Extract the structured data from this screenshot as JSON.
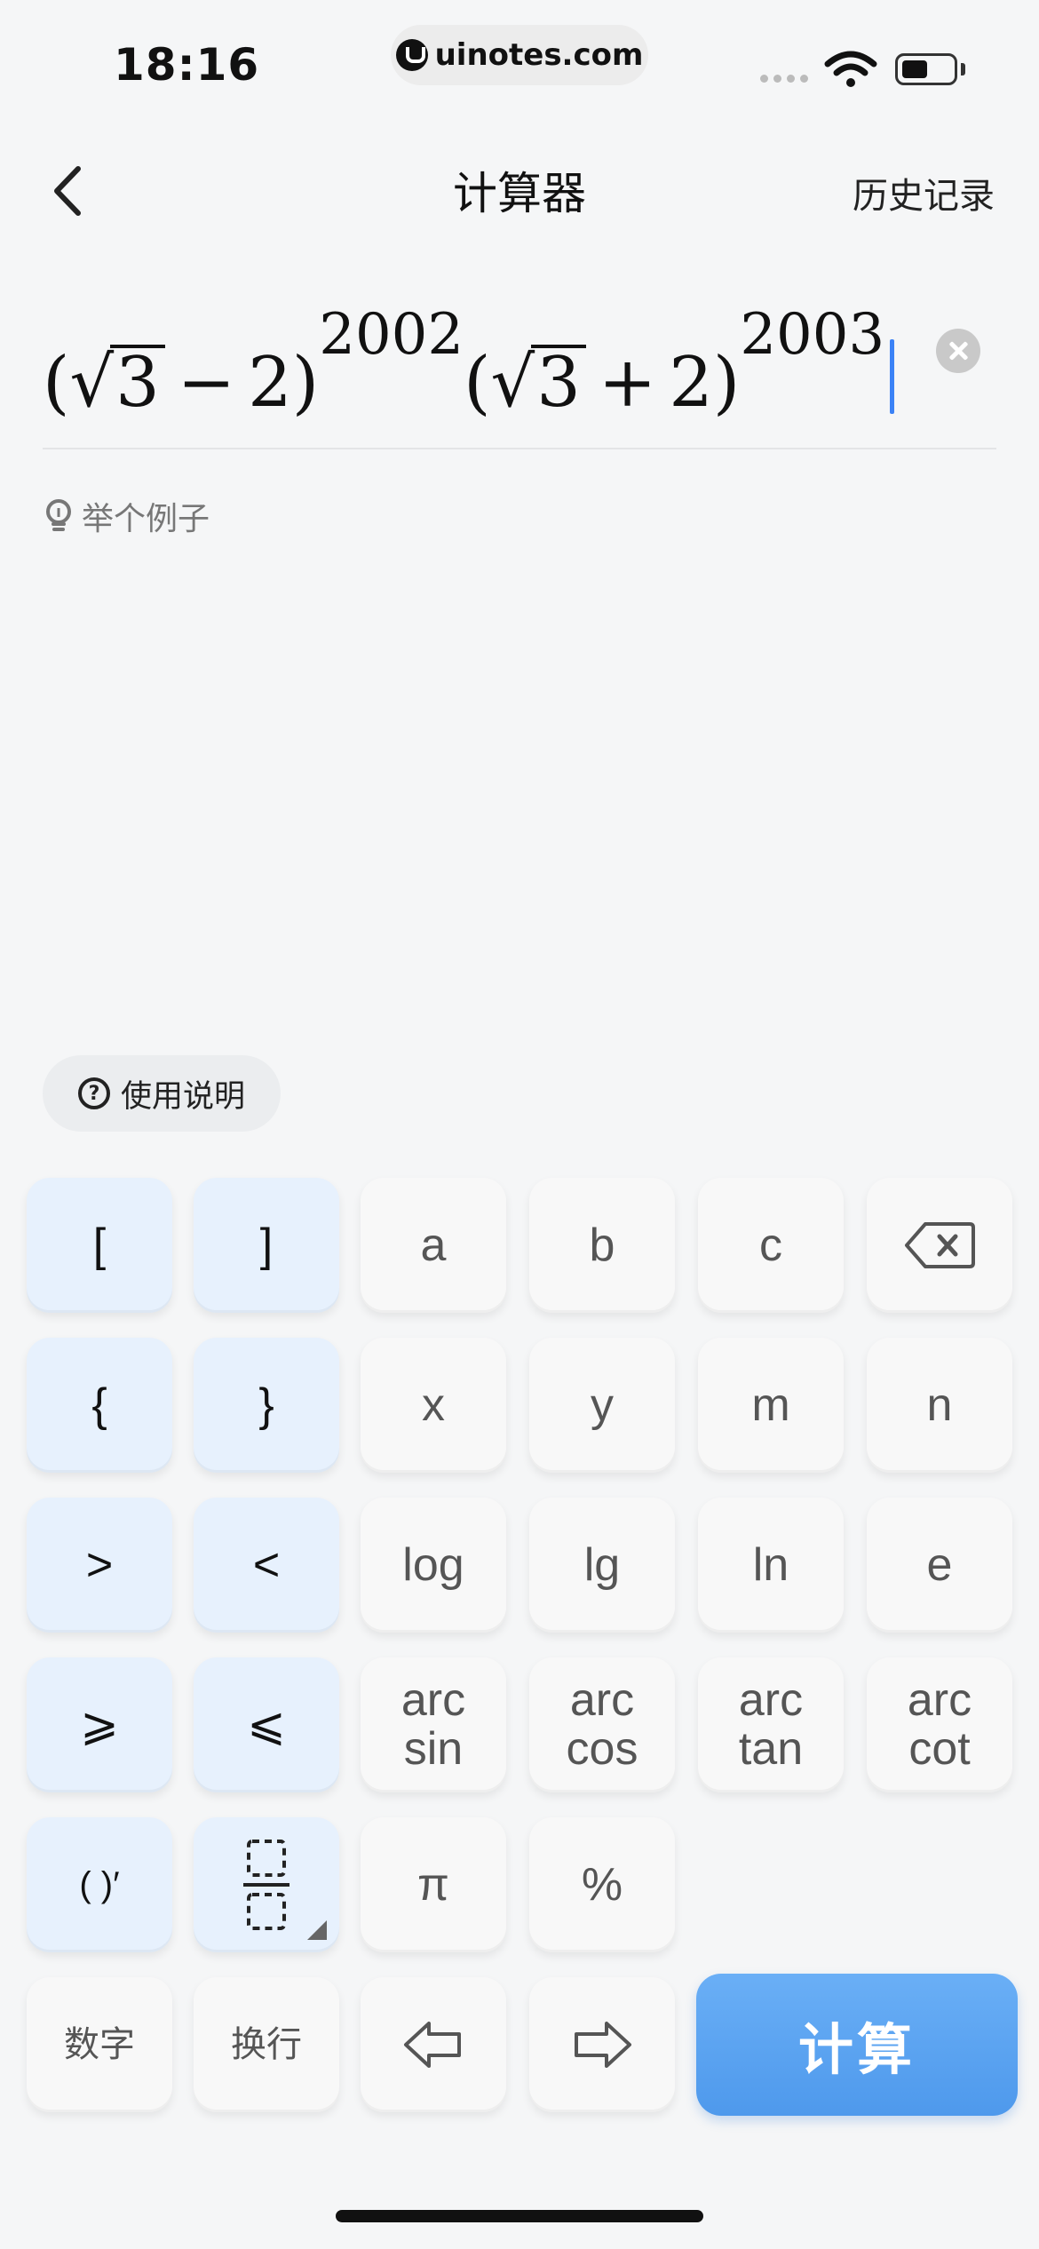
{
  "status_bar": {
    "time": "18:16",
    "url": "uinotes.com"
  },
  "nav": {
    "title": "计算器",
    "history": "历史记录"
  },
  "formula": {
    "p1": "(",
    "r1": "3",
    "op1": "−",
    "n1": "2",
    "p2": ")",
    "e1": "2002",
    "p3": "(",
    "r2": "3",
    "op2": "+",
    "n2": "2",
    "p4": ")",
    "e2": "2003"
  },
  "example_label": "举个例子",
  "help_label": "使用说明",
  "keypad": {
    "row1": [
      "[",
      "]",
      "a",
      "b",
      "c"
    ],
    "row2": [
      "{",
      "}",
      "x",
      "y",
      "m",
      "n"
    ],
    "row3": [
      ">",
      "<",
      "log",
      "lg",
      "ln",
      "e"
    ],
    "row4": [
      "⩾",
      "⩽",
      "arc sin",
      "arc cos",
      "arc tan",
      "arc cot"
    ],
    "row4_top": [
      "arc",
      "arc",
      "arc",
      "arc"
    ],
    "row4_bottom": [
      "sin",
      "cos",
      "tan",
      "cot"
    ],
    "row5": [
      "( )′",
      "π",
      "%"
    ],
    "row6": [
      "数字",
      "换行"
    ],
    "calculate": "计算"
  },
  "icons": [
    "back-icon",
    "clear-icon",
    "bulb-icon",
    "help-icon",
    "backspace-icon",
    "fraction-icon",
    "arrow-left-icon",
    "arrow-right-icon",
    "wifi-icon",
    "battery-icon"
  ],
  "colors": {
    "accent": "#4e99ec",
    "key_blue": "#e7f1fd",
    "cursor": "#3b82f6"
  }
}
